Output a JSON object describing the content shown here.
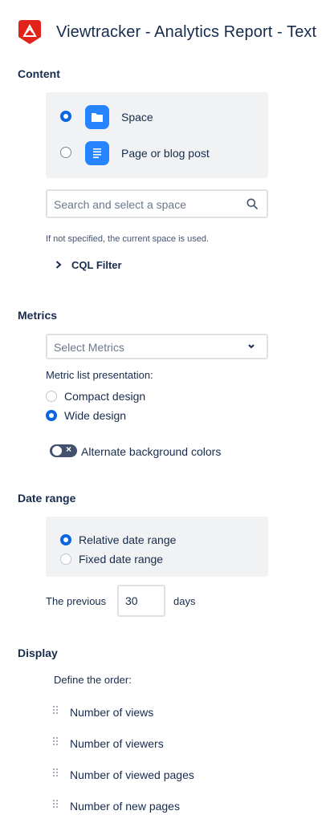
{
  "header": {
    "title": "Viewtracker - Analytics Report - Text",
    "logo_icon": "viewtracker-logo-icon"
  },
  "content": {
    "heading": "Content",
    "options": [
      {
        "label": "Space",
        "selected": true,
        "icon": "folder-icon"
      },
      {
        "label": "Page or blog post",
        "selected": false,
        "icon": "document-icon"
      }
    ],
    "search_placeholder": "Search and select a space",
    "hint": "If not specified, the current space is used.",
    "cql_filter": "CQL Filter"
  },
  "metrics": {
    "heading": "Metrics",
    "select_placeholder": "Select Metrics",
    "presentation_label": "Metric list presentation:",
    "presentation_options": [
      {
        "label": "Compact design",
        "selected": false
      },
      {
        "label": "Wide design",
        "selected": true
      }
    ],
    "alternate_label": "Alternate background colors",
    "alternate_enabled": false
  },
  "date_range": {
    "heading": "Date range",
    "options": [
      {
        "label": "Relative date range",
        "selected": true
      },
      {
        "label": "Fixed date range",
        "selected": false
      }
    ],
    "previous_label": "The previous",
    "days_value": "30",
    "days_label": "days"
  },
  "display": {
    "heading": "Display",
    "order_label": "Define the order:",
    "items": [
      "Number of views",
      "Number of viewers",
      "Number of viewed pages",
      "Number of new pages"
    ]
  },
  "colors": {
    "accent": "#0c66e4",
    "icon_blue": "#2684ff",
    "logo_red": "#e2231a",
    "panel": "#f1f2f4"
  }
}
